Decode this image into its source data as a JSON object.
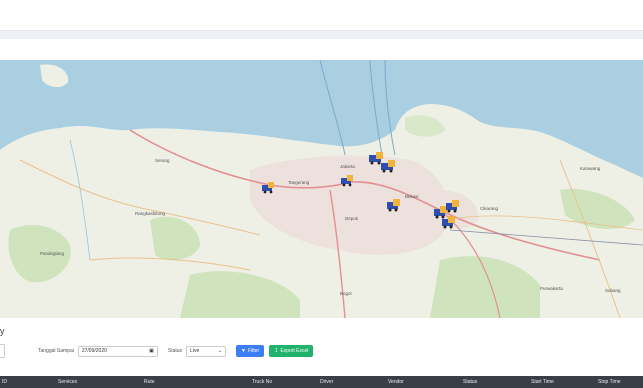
{
  "section_title": "y",
  "filters": {
    "date_label": "Tanggal Sampai",
    "date_value": "27/09/2020",
    "status_label": "Status",
    "status_value": "Live",
    "filter_button": "Filter",
    "export_button": "Export Excel"
  },
  "table": {
    "columns": [
      "ID",
      "Services",
      "Rute",
      "Truck No",
      "Driver",
      "Vendor",
      "Status",
      "Start Time",
      "Stop Time"
    ]
  },
  "map": {
    "place_labels": [
      "Serang",
      "Tangerang",
      "Jakarta",
      "Bekasi",
      "Depok",
      "Bogor",
      "Cikarang",
      "Karawang",
      "Purwakarta",
      "Subang",
      "Rangkasbitung",
      "Pandeglang"
    ],
    "colors": {
      "sea": "#a9cfe0",
      "land": "#eef0e6",
      "forest": "#cfe4bd",
      "urban": "#ece1dc",
      "motorway": "#e38f8f",
      "truck": "#2f4fb0"
    }
  }
}
